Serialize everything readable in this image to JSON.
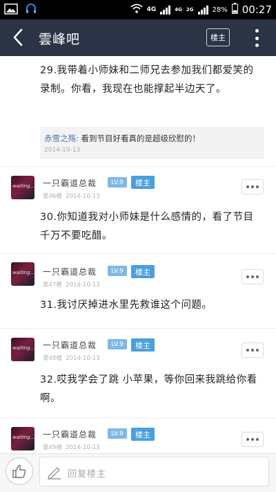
{
  "status_bar": {
    "network_4g": "4G",
    "network_4g_small": "4G",
    "network_2g": "2G",
    "battery": "28%",
    "time": "00:27"
  },
  "header": {
    "title": "雲峰吧",
    "louzhu_button": "楼主"
  },
  "posts": [
    {
      "text": "29.我带着小师妹和二师兄去参加我们都爱笑的录制。你看，我现在也能撑起半边天了。",
      "reply": {
        "author": "赤雪之殇:",
        "text": "看到节目好看真的是超级欣慰的！",
        "date": "2014-10-13"
      }
    },
    {
      "avatar_text": "waiting… for you",
      "username": "一只霸道总裁",
      "level": "LV.9",
      "badge": "楼主",
      "floor": "第46楼",
      "date": "2014-10-13",
      "text": "30.你知道我对小师妹是什么感情的，看了节目千万不要吃醋。"
    },
    {
      "avatar_text": "waiting… for you",
      "username": "一只霸道总裁",
      "level": "LV.9",
      "badge": "楼主",
      "floor": "第47楼",
      "date": "2014-10-13",
      "text": "31.我讨厌掉进水里先救谁这个问题。"
    },
    {
      "avatar_text": "waiting… for you",
      "username": "一只霸道总裁",
      "level": "LV.9",
      "badge": "楼主",
      "floor": "第48楼",
      "date": "2014-10-13",
      "text": "32.哎我学会了跳 小苹果，等你回来我跳给你看啊。"
    },
    {
      "avatar_text": "waiting… for you",
      "username": "一只霸道总裁",
      "level": "LV.9",
      "badge": "楼主",
      "floor": "第49楼",
      "date": "2014-10-13"
    }
  ],
  "bottom_bar": {
    "reply_placeholder": "回复楼主"
  },
  "icons": {
    "status_left": [
      "image-icon",
      "headset-icon"
    ],
    "status_right": [
      "wifi-icon",
      "signal-icon",
      "battery-icon"
    ],
    "header": [
      "back-arrow-icon",
      "more-vertical-icon"
    ],
    "posts": [
      "more-horizontal-icon"
    ],
    "bottom": [
      "thumbs-up-icon",
      "pencil-icon"
    ]
  },
  "colors": {
    "header_bg": "#2b3446",
    "reply_author": "#4d73b2",
    "level_badge": "#7fb8e6",
    "louzhu_badge": "#4a9fdf"
  }
}
